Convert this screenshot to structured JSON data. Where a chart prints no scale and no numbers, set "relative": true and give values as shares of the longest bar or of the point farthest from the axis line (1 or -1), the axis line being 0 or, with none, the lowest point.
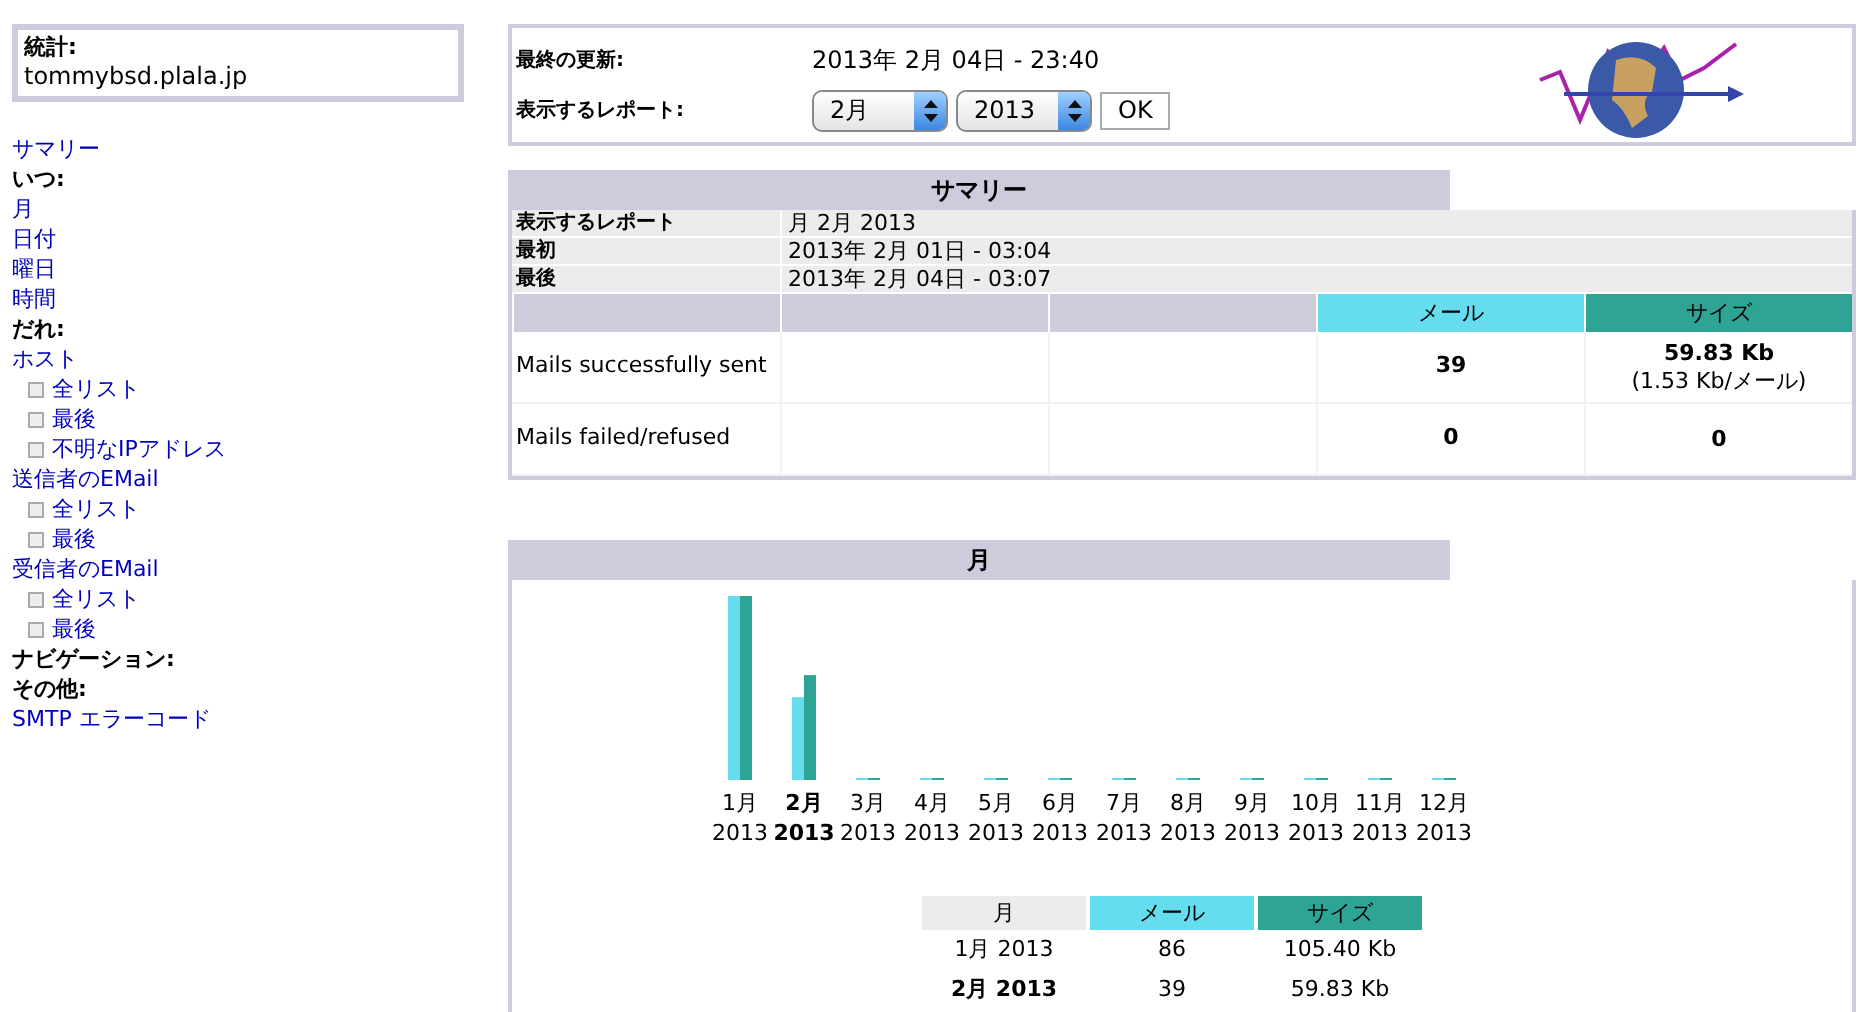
{
  "sidebar": {
    "stats_label": "統計:",
    "site": "tommybsd.plala.jp",
    "menu": [
      {
        "kind": "link",
        "label": "サマリー"
      },
      {
        "kind": "heading",
        "label": "いつ:"
      },
      {
        "kind": "link",
        "label": "月"
      },
      {
        "kind": "link",
        "label": "日付"
      },
      {
        "kind": "link",
        "label": "曜日"
      },
      {
        "kind": "link",
        "label": "時間"
      },
      {
        "kind": "heading",
        "label": "だれ:"
      },
      {
        "kind": "link",
        "label": "ホスト",
        "children": [
          {
            "kind": "link",
            "label": "全リスト"
          },
          {
            "kind": "link",
            "label": "最後"
          },
          {
            "kind": "link",
            "label": "不明なIPアドレス"
          }
        ]
      },
      {
        "kind": "link",
        "label": "送信者のEMail",
        "children": [
          {
            "kind": "link",
            "label": "全リスト"
          },
          {
            "kind": "link",
            "label": "最後"
          }
        ]
      },
      {
        "kind": "link",
        "label": "受信者のEMail",
        "children": [
          {
            "kind": "link",
            "label": "全リスト"
          },
          {
            "kind": "link",
            "label": "最後"
          }
        ]
      },
      {
        "kind": "heading",
        "label": "ナビゲーション:"
      },
      {
        "kind": "heading",
        "label": "その他:"
      },
      {
        "kind": "link",
        "label": "SMTP エラーコード"
      }
    ]
  },
  "header": {
    "last_update_label": "最終の更新:",
    "last_update": "2013年 2月 04日 - 23:40",
    "report_label": "表示するレポート:",
    "month_select": "2月",
    "year_select": "2013",
    "ok_button": "OK"
  },
  "summary": {
    "title": "サマリー",
    "info_rows": [
      {
        "label": "表示するレポート",
        "value": "月 2月 2013"
      },
      {
        "label": "最初",
        "value": "2013年 2月 01日 - 03:04"
      },
      {
        "label": "最後",
        "value": "2013年 2月 04日 - 03:07"
      }
    ],
    "columns": [
      "メール",
      "サイズ"
    ],
    "rows": [
      {
        "label": "Mails successfully sent",
        "mail": "39",
        "size": "59.83 Kb",
        "size_note": "(1.53 Kb/メール)"
      },
      {
        "label": "Mails failed/refused",
        "mail": "0",
        "size": "0"
      }
    ]
  },
  "monthly": {
    "title": "月",
    "chart_data": {
      "type": "bar",
      "relative": true,
      "categories": [
        "1月 2013",
        "2月 2013",
        "3月 2013",
        "4月 2013",
        "5月 2013",
        "6月 2013",
        "7月 2013",
        "8月 2013",
        "9月 2013",
        "10月 2013",
        "11月 2013",
        "12月 2013"
      ],
      "series": [
        {
          "name": "メール",
          "color": "#66ddee",
          "values": [
            1,
            0.45,
            0,
            0,
            0,
            0,
            0,
            0,
            0,
            0,
            0,
            0
          ]
        },
        {
          "name": "サイズ",
          "color": "#2ea495",
          "values": [
            1,
            0.57,
            0,
            0,
            0,
            0,
            0,
            0,
            0,
            0,
            0,
            0
          ]
        }
      ]
    },
    "category_states": [
      {
        "selected": false
      },
      {
        "selected": true
      },
      {
        "selected": false
      },
      {
        "selected": false
      },
      {
        "selected": false
      },
      {
        "selected": false
      },
      {
        "selected": false
      },
      {
        "selected": false
      },
      {
        "selected": false
      },
      {
        "selected": false
      },
      {
        "selected": false
      },
      {
        "selected": false
      }
    ],
    "table": {
      "columns": [
        "月"
      ],
      "rows": [
        {
          "month": "1月 2013",
          "mail": "86",
          "size": "105.40 Kb",
          "selected": false
        },
        {
          "month": "2月 2013",
          "mail": "39",
          "size": "59.83 Kb",
          "selected": true
        }
      ]
    }
  }
}
